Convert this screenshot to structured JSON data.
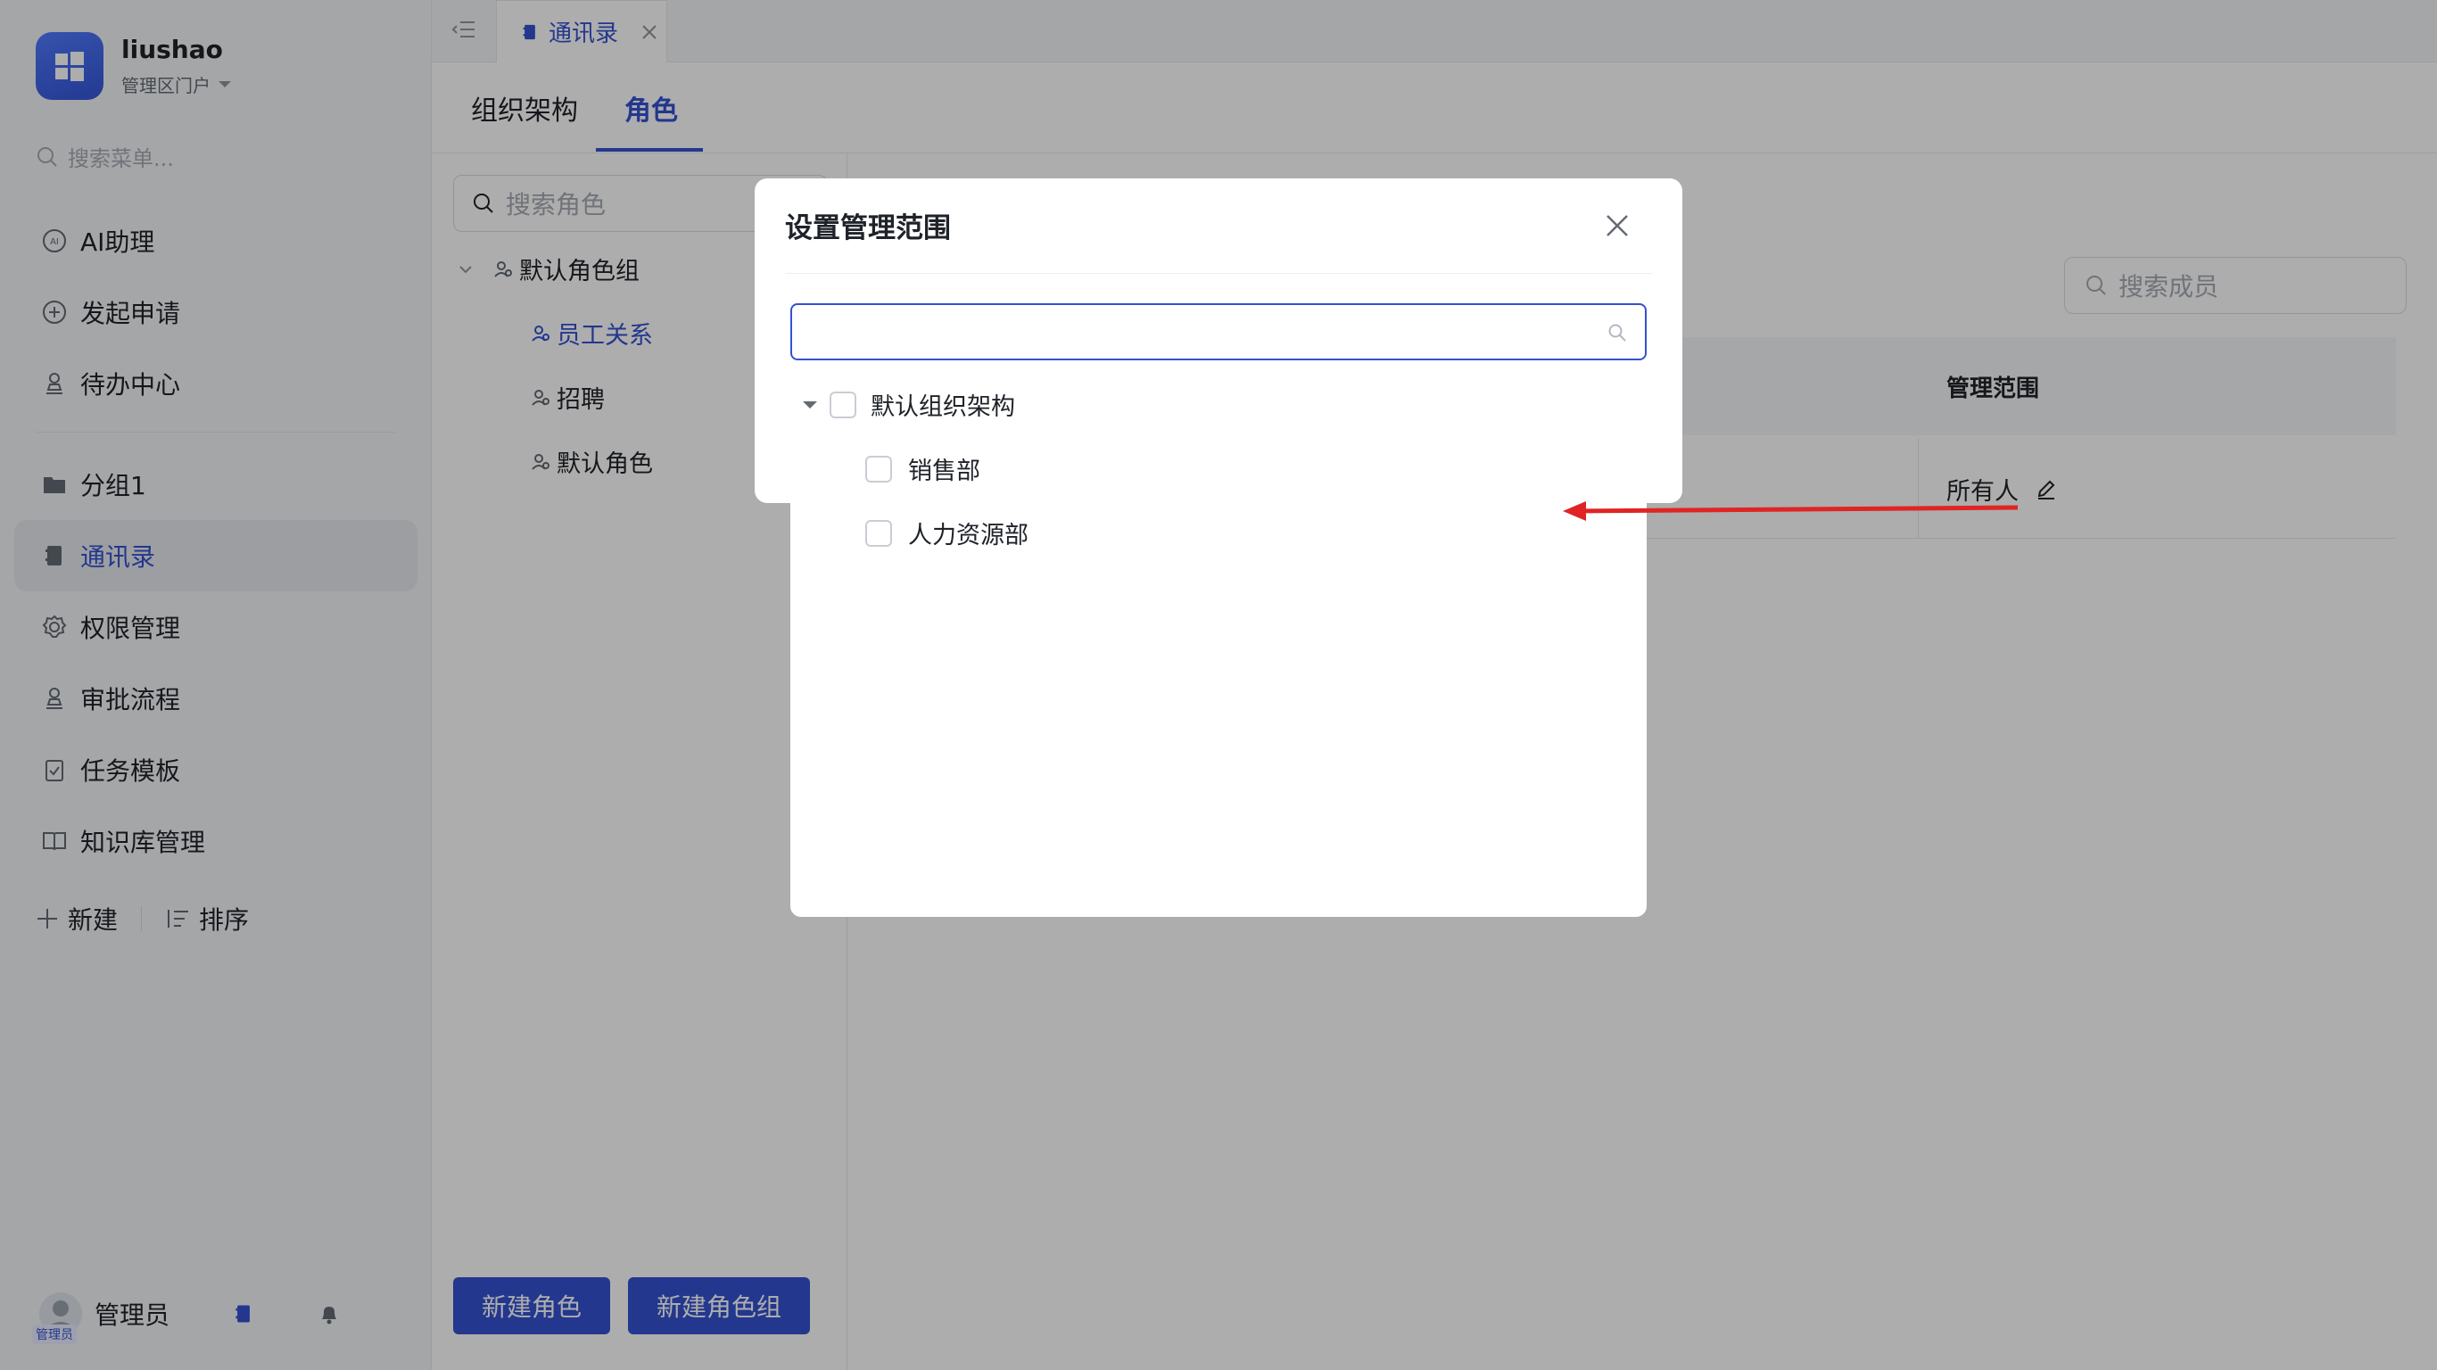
{
  "brand": {
    "name": "liushao",
    "portal": "管理区门户"
  },
  "sidebar": {
    "search_placeholder": "搜索菜单...",
    "items": [
      {
        "label": "AI助理"
      },
      {
        "label": "发起申请"
      },
      {
        "label": "待办中心"
      },
      {
        "label": "分组1"
      },
      {
        "label": "通讯录"
      },
      {
        "label": "权限管理"
      },
      {
        "label": "审批流程"
      },
      {
        "label": "任务模板"
      },
      {
        "label": "知识库管理"
      }
    ],
    "new_label": "新建",
    "sort_label": "排序",
    "footer_user": "管理员",
    "avatar_badge": "管理员"
  },
  "tabs": [
    {
      "label": "通讯录"
    }
  ],
  "subtabs": [
    {
      "label": "组织架构"
    },
    {
      "label": "角色"
    }
  ],
  "roles": {
    "search_placeholder": "搜索角色",
    "group": "默认角色组",
    "items": [
      {
        "label": "员工关系"
      },
      {
        "label": "招聘"
      },
      {
        "label": "默认角色"
      }
    ],
    "new_role_button": "新建角色",
    "new_group_button": "新建角色组"
  },
  "members": {
    "search_placeholder": "搜索成员",
    "column_scope": "管理范围",
    "row_scope": "所有人"
  },
  "modal": {
    "title": "设置管理范围",
    "search_value": "",
    "tree": {
      "root": "默认组织架构",
      "children": [
        {
          "label": "销售部"
        },
        {
          "label": "人力资源部"
        }
      ]
    }
  },
  "colors": {
    "accent": "#3451d1",
    "annotation_arrow": "#e02424"
  }
}
